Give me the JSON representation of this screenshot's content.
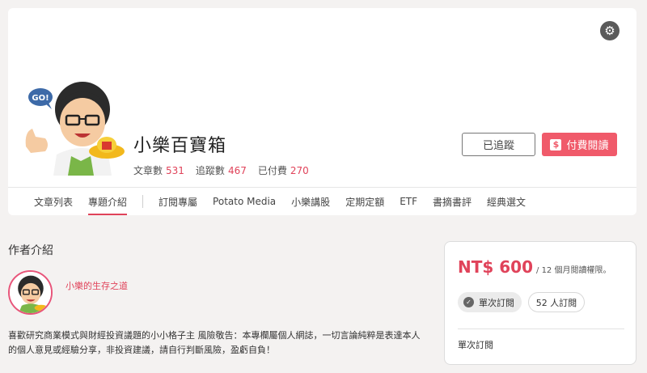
{
  "header": {
    "title": "小樂百寶箱",
    "stats": [
      {
        "label": "文章數",
        "value": "531"
      },
      {
        "label": "追蹤數",
        "value": "467"
      },
      {
        "label": "已付費",
        "value": "270"
      }
    ],
    "follow_label": "已追蹤",
    "pay_label": "付費閱讀",
    "pay_icon_glyph": "$",
    "avatar_badge_text": "GO!"
  },
  "tabs": {
    "group1": [
      "文章列表",
      "專題介紹"
    ],
    "group2": [
      "訂閱專屬",
      "Potato Media",
      "小樂講股",
      "定期定額",
      "ETF",
      "書摘書評",
      "經典選文"
    ],
    "active": "專題介紹"
  },
  "author": {
    "section_title": "作者介紹",
    "name": "小樂的生存之道",
    "bio": "喜歡研究商業模式與財經投資議題的小小格子主 風險敬告：本專欄屬個人網誌，一切言論純粹是表達本人的個人意見或經驗分享，非投資建議，請自行判斷風險，盈虧自負！"
  },
  "pricing": {
    "price": "NT$ 600",
    "price_note": "/ 12 個月閱讀權限。",
    "option_selected": "單次訂閱",
    "option_other": "52 人訂閱",
    "plan_label": "單次訂閱"
  },
  "colors": {
    "accent": "#e0435a",
    "pay_button": "#f05a6a",
    "background": "#f4f2f1"
  },
  "icons": {
    "settings": "gear-icon",
    "check": "check-icon"
  }
}
